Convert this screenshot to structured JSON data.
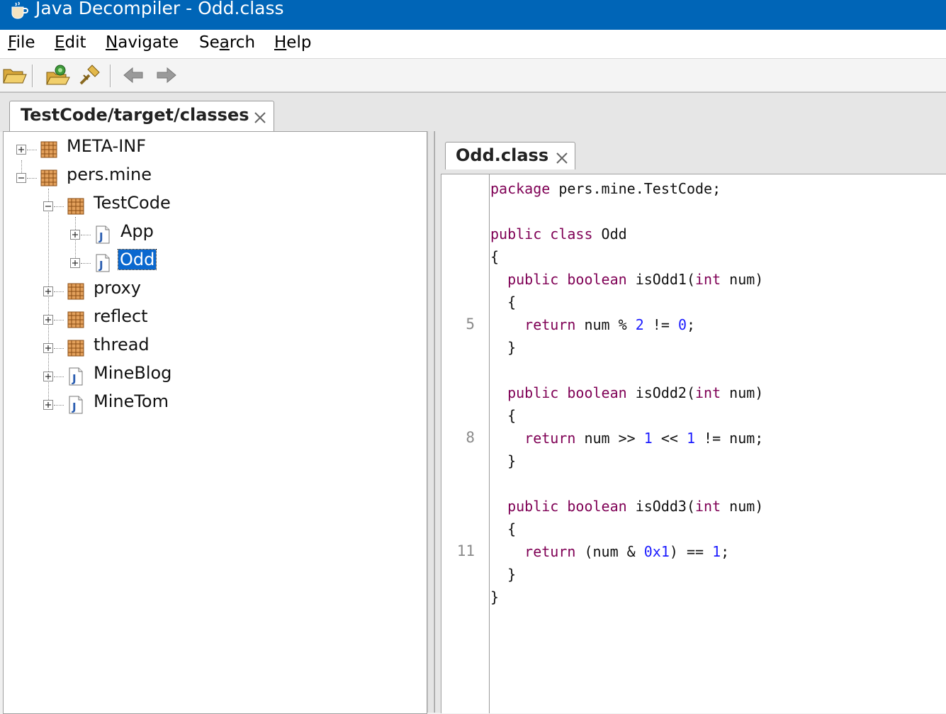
{
  "window": {
    "title": "Java Decompiler - Odd.class"
  },
  "menu": [
    {
      "underline": "F",
      "rest": "ile"
    },
    {
      "underline": "E",
      "rest": "dit"
    },
    {
      "underline": "N",
      "rest": "avigate"
    },
    {
      "pre": "Se",
      "underline": "a",
      "rest": "rch"
    },
    {
      "underline": "H",
      "rest": "elp"
    }
  ],
  "toolbar": {
    "buttons": [
      "open-file-icon",
      "open-type-icon",
      "search-icon",
      "back-arrow-icon",
      "forward-arrow-icon"
    ]
  },
  "outer_tab": {
    "label": "TestCode/target/classes"
  },
  "tree": {
    "meta_inf": "META-INF",
    "pers_mine": "pers.mine",
    "testcode": "TestCode",
    "app": "App",
    "odd": "Odd",
    "proxy": "proxy",
    "reflect": "reflect",
    "thread": "thread",
    "mineblog": "MineBlog",
    "minetom": "MineTom"
  },
  "editor_tab": {
    "label": "Odd.class"
  },
  "line_numbers": [
    "5",
    "8",
    "11"
  ],
  "code": {
    "l1_kw": "package",
    "l1_rest": " pers.mine.TestCode;",
    "l2_kw": "public class",
    "l2_rest": " Odd",
    "brace_open": "{",
    "brace_close": "}",
    "m1_kw1": "public boolean",
    "m1_name": " isOdd1(",
    "m1_kw2": "int",
    "m1_tail": " num)",
    "m1_ret": "return",
    "m1_expr_a": " num % ",
    "m1_n1": "2",
    "m1_expr_b": " != ",
    "m1_n2": "0",
    "m1_end": ";",
    "m2_kw1": "public boolean",
    "m2_name": " isOdd2(",
    "m2_kw2": "int",
    "m2_tail": " num)",
    "m2_ret": "return",
    "m2_expr_a": " num >> ",
    "m2_n1": "1",
    "m2_expr_b": " << ",
    "m2_n2": "1",
    "m2_end": " != num;",
    "m3_kw1": "public boolean",
    "m3_name": " isOdd3(",
    "m3_kw2": "int",
    "m3_tail": " num)",
    "m3_ret": "return",
    "m3_expr_a": " (num & ",
    "m3_n1": "0x1",
    "m3_expr_b": ") == ",
    "m3_n2": "1",
    "m3_end": ";"
  }
}
